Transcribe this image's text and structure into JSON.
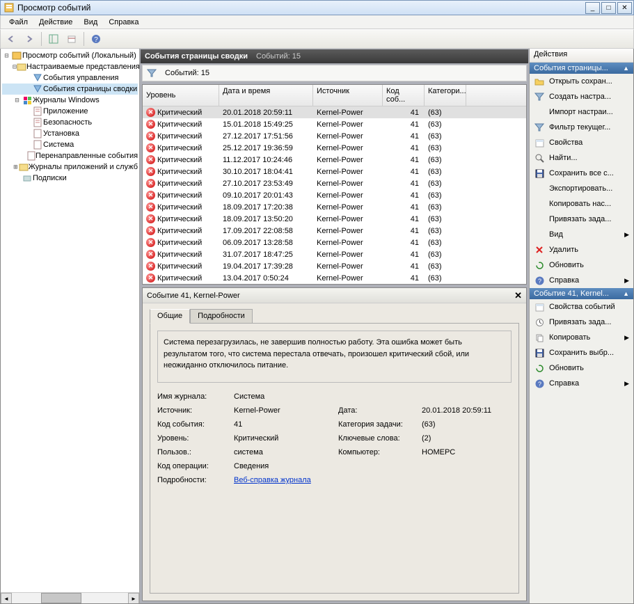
{
  "window": {
    "title": "Просмотр событий"
  },
  "menu": {
    "file": "Файл",
    "action": "Действие",
    "view": "Вид",
    "help": "Справка"
  },
  "tree": {
    "root": "Просмотр событий (Локальный)",
    "custom_views": "Настраиваемые представления",
    "admin_events": "События управления",
    "summary_events": "События страницы сводки",
    "win_logs": "Журналы Windows",
    "application": "Приложение",
    "security": "Безопасность",
    "setup": "Установка",
    "system": "Система",
    "forwarded": "Перенаправленные события",
    "app_service": "Журналы приложений и служб",
    "subscriptions": "Подписки"
  },
  "main_header": {
    "title": "События страницы сводки",
    "count_label": "Событий: 15"
  },
  "filter_bar": {
    "count_label": "Событий: 15"
  },
  "columns": {
    "level": "Уровень",
    "datetime": "Дата и время",
    "source": "Источник",
    "eventcode": "Код соб...",
    "category": "Категори..."
  },
  "level_critical": "Критический",
  "events": [
    {
      "date": "20.01.2018 20:59:11",
      "source": "Kernel-Power",
      "code": "41",
      "cat": "(63)"
    },
    {
      "date": "15.01.2018 15:49:25",
      "source": "Kernel-Power",
      "code": "41",
      "cat": "(63)"
    },
    {
      "date": "27.12.2017 17:51:56",
      "source": "Kernel-Power",
      "code": "41",
      "cat": "(63)"
    },
    {
      "date": "25.12.2017 19:36:59",
      "source": "Kernel-Power",
      "code": "41",
      "cat": "(63)"
    },
    {
      "date": "11.12.2017 10:24:46",
      "source": "Kernel-Power",
      "code": "41",
      "cat": "(63)"
    },
    {
      "date": "30.10.2017 18:04:41",
      "source": "Kernel-Power",
      "code": "41",
      "cat": "(63)"
    },
    {
      "date": "27.10.2017 23:53:49",
      "source": "Kernel-Power",
      "code": "41",
      "cat": "(63)"
    },
    {
      "date": "09.10.2017 20:01:43",
      "source": "Kernel-Power",
      "code": "41",
      "cat": "(63)"
    },
    {
      "date": "18.09.2017 17:20:38",
      "source": "Kernel-Power",
      "code": "41",
      "cat": "(63)"
    },
    {
      "date": "18.09.2017 13:50:20",
      "source": "Kernel-Power",
      "code": "41",
      "cat": "(63)"
    },
    {
      "date": "17.09.2017 22:08:58",
      "source": "Kernel-Power",
      "code": "41",
      "cat": "(63)"
    },
    {
      "date": "06.09.2017 13:28:58",
      "source": "Kernel-Power",
      "code": "41",
      "cat": "(63)"
    },
    {
      "date": "31.07.2017 18:47:25",
      "source": "Kernel-Power",
      "code": "41",
      "cat": "(63)"
    },
    {
      "date": "19.04.2017 17:39:28",
      "source": "Kernel-Power",
      "code": "41",
      "cat": "(63)"
    },
    {
      "date": "13.04.2017 0:50:24",
      "source": "Kernel-Power",
      "code": "41",
      "cat": "(63)"
    }
  ],
  "details": {
    "title": "Событие 41, Kernel-Power",
    "tabs": {
      "general": "Общие",
      "details": "Подробности"
    },
    "description": "Система перезагрузилась, не завершив полностью работу. Эта ошибка может быть результатом того, что система перестала отвечать, произошел критический сбой, или неожиданно отключилось питание.",
    "labels": {
      "log_name": "Имя журнала:",
      "source": "Источник:",
      "date": "Дата:",
      "event_code": "Код события:",
      "task_cat": "Категория задачи:",
      "level": "Уровень:",
      "keywords": "Ключевые слова:",
      "user": "Пользов.:",
      "computer": "Компьютер:",
      "opcode": "Код операции:",
      "more_info": "Подробности:",
      "help_link": "Веб-справка журнала"
    },
    "values": {
      "log_name": "Система",
      "source": "Kernel-Power",
      "date": "20.01.2018 20:59:11",
      "event_code": "41",
      "task_cat": "(63)",
      "level": "Критический",
      "keywords": "(2)",
      "user": "система",
      "computer": "НОМЕРС",
      "opcode": "Сведения"
    }
  },
  "actions": {
    "title": "Действия",
    "group1_title": "События страницы...",
    "open_saved": "Открыть сохран...",
    "create_custom": "Создать настра...",
    "import": "Импорт настраи...",
    "filter": "Фильтр текущег...",
    "properties": "Свойства",
    "find": "Найти...",
    "save_all": "Сохранить все с...",
    "export": "Экспортировать...",
    "copy_custom": "Копировать нас...",
    "attach_task": "Привязать зада...",
    "view": "Вид",
    "delete": "Удалить",
    "refresh": "Обновить",
    "help": "Справка",
    "group2_title": "Событие 41, Kernel...",
    "event_props": "Свойства событий",
    "attach_task2": "Привязать зада...",
    "copy": "Копировать",
    "save_selected": "Сохранить выбр...",
    "refresh2": "Обновить",
    "help2": "Справка"
  }
}
